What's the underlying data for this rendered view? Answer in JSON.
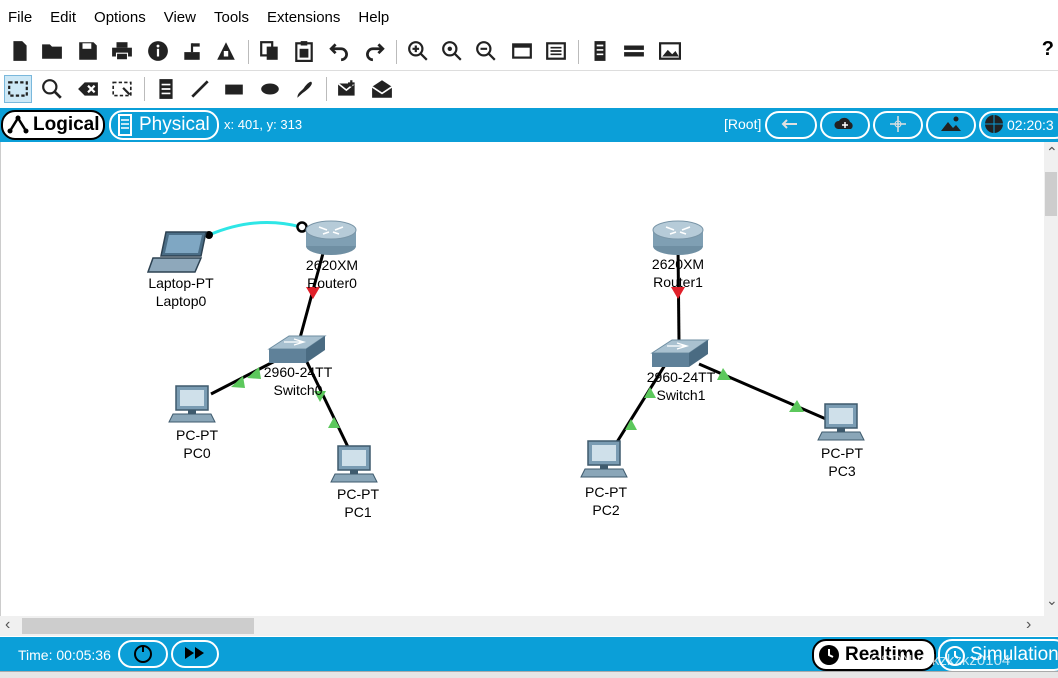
{
  "menu": [
    {
      "label": "File"
    },
    {
      "label": "Edit"
    },
    {
      "label": "Options"
    },
    {
      "label": "View"
    },
    {
      "label": "Tools"
    },
    {
      "label": "Extensions"
    },
    {
      "label": "Help"
    }
  ],
  "toolbar": {
    "help_label": "?"
  },
  "modebar": {
    "logical_label": "Logical",
    "physical_label": "Physical",
    "coords": "x: 401, y: 313",
    "root_label": "[Root]",
    "clock": "02:20:3"
  },
  "devices": [
    {
      "model": "Laptop-PT",
      "name": "Laptop0"
    },
    {
      "model": "2620XM",
      "name": "Router0"
    },
    {
      "model": "2960-24TT",
      "name": "Switch0"
    },
    {
      "model": "PC-PT",
      "name": "PC0"
    },
    {
      "model": "PC-PT",
      "name": "PC1"
    },
    {
      "model": "2620XM",
      "name": "Router1"
    },
    {
      "model": "2960-24TT",
      "name": "Switch1"
    },
    {
      "model": "PC-PT",
      "name": "PC2"
    },
    {
      "model": "PC-PT",
      "name": "PC3"
    }
  ],
  "bottombar": {
    "time_label": "Time: 00:05:36",
    "realtime_label": "Realtime",
    "simulation_label": "Simulation",
    "watermark": "CSDN @kzkzkz0104"
  },
  "colors": {
    "accent": "#0b9fd8",
    "console_cable": "#2ee6e6",
    "link_up": "#5cc85c",
    "link_down": "#e0202a"
  }
}
